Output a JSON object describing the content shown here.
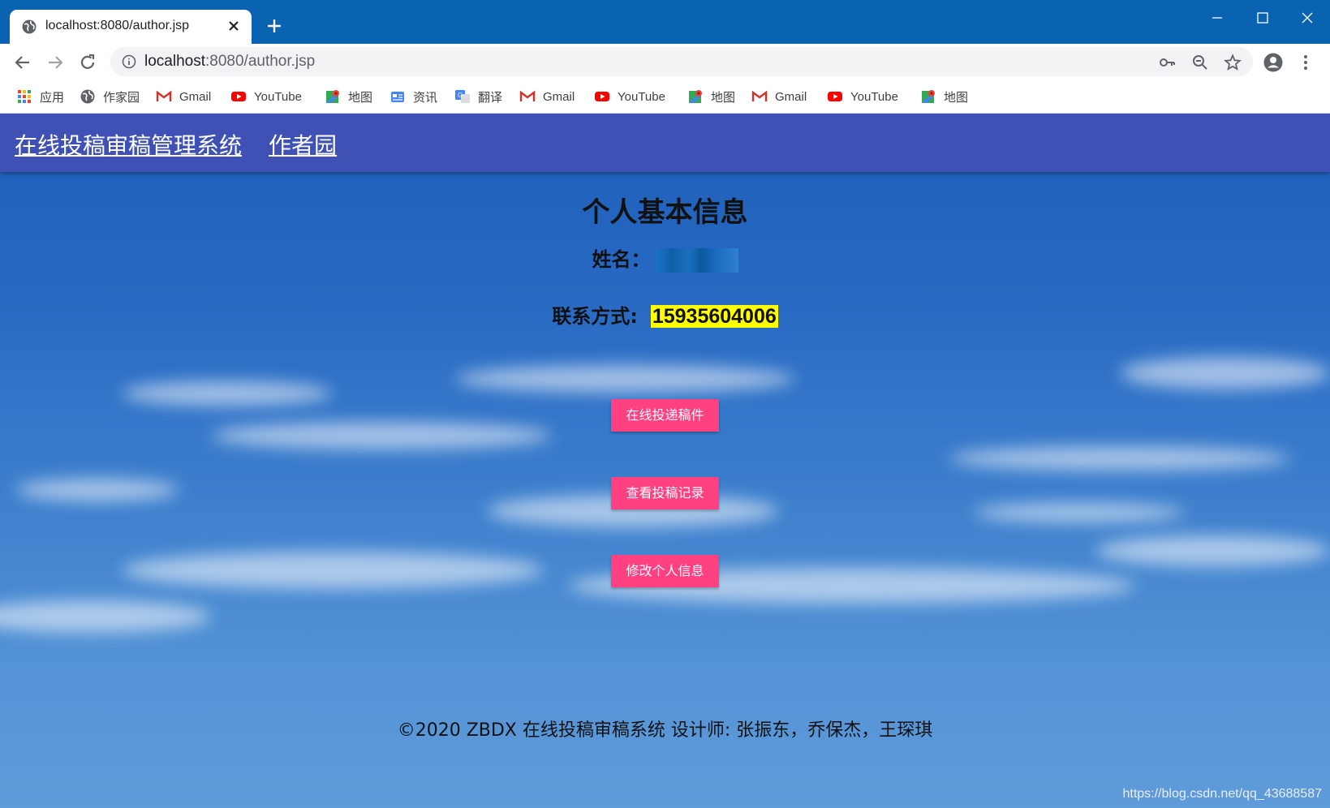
{
  "browser": {
    "tab_title": "localhost:8080/author.jsp",
    "url_host": "localhost",
    "url_rest": ":8080/author.jsp"
  },
  "bookmarks": [
    {
      "label": "应用",
      "icon": "apps-grid-icon"
    },
    {
      "label": "作家园",
      "icon": "globe-icon"
    },
    {
      "label": "Gmail",
      "icon": "gmail-icon"
    },
    {
      "label": "YouTube",
      "icon": "youtube-icon"
    },
    {
      "label": "地图",
      "icon": "maps-icon"
    },
    {
      "label": "资讯",
      "icon": "news-icon"
    },
    {
      "label": "翻译",
      "icon": "translate-icon"
    },
    {
      "label": "Gmail",
      "icon": "gmail-icon"
    },
    {
      "label": "YouTube",
      "icon": "youtube-icon"
    },
    {
      "label": "地图",
      "icon": "maps-icon"
    },
    {
      "label": "Gmail",
      "icon": "gmail-icon"
    },
    {
      "label": "YouTube",
      "icon": "youtube-icon"
    },
    {
      "label": "地图",
      "icon": "maps-icon"
    }
  ],
  "nav": {
    "brand": "在线投稿审稿管理系统",
    "author_link": "作者园"
  },
  "profile": {
    "heading": "个人基本信息",
    "name_label": "姓名：",
    "contact_label": "联系方式:",
    "phone": "15935604006"
  },
  "actions": {
    "submit": "在线投递稿件",
    "view_records": "查看投稿记录",
    "edit_profile": "修改个人信息"
  },
  "footer": {
    "text": "©2020 ZBDX 在线投稿审稿系统 设计师: 张振东，乔保杰，王琛琪",
    "watermark": "https://blog.csdn.net/qq_43688587"
  },
  "colors": {
    "titlebar": "#0a63b0",
    "navbar": "#3f51b5",
    "button": "#ff4081",
    "phone_highlight": "#ffff00"
  }
}
